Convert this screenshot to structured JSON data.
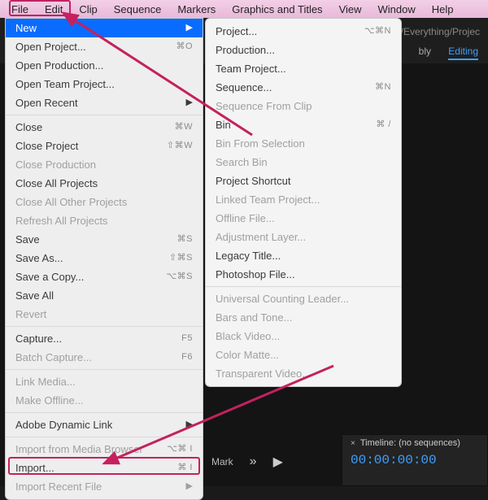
{
  "menubar": [
    "File",
    "Edit",
    "Clip",
    "Sequence",
    "Markers",
    "Graphics and Titles",
    "View",
    "Window",
    "Help"
  ],
  "dark": {
    "breadcrumb": "/Everything/Projec",
    "tab_active": "Editing",
    "tab_other": "bly"
  },
  "file_menu": [
    {
      "label": "New",
      "short": "",
      "arrow": true,
      "hot": true
    },
    {
      "label": "Open Project...",
      "short": "⌘O"
    },
    {
      "label": "Open Production..."
    },
    {
      "label": "Open Team Project..."
    },
    {
      "label": "Open Recent",
      "arrow": true
    },
    {
      "sep": true
    },
    {
      "label": "Close",
      "short": "⌘W"
    },
    {
      "label": "Close Project",
      "short": "⇧⌘W"
    },
    {
      "label": "Close Production",
      "dim": true
    },
    {
      "label": "Close All Projects"
    },
    {
      "label": "Close All Other Projects",
      "dim": true
    },
    {
      "label": "Refresh All Projects",
      "dim": true
    },
    {
      "label": "Save",
      "short": "⌘S"
    },
    {
      "label": "Save As...",
      "short": "⇧⌘S"
    },
    {
      "label": "Save a Copy...",
      "short": "⌥⌘S"
    },
    {
      "label": "Save All"
    },
    {
      "label": "Revert",
      "dim": true
    },
    {
      "sep": true
    },
    {
      "label": "Capture...",
      "short": "F5"
    },
    {
      "label": "Batch Capture...",
      "short": "F6",
      "dim": true
    },
    {
      "sep": true
    },
    {
      "label": "Link Media...",
      "dim": true
    },
    {
      "label": "Make Offline...",
      "dim": true
    },
    {
      "sep": true
    },
    {
      "label": "Adobe Dynamic Link",
      "arrow": true
    },
    {
      "sep": true
    },
    {
      "label": "Import from Media Browser",
      "short": "⌥⌘ I",
      "dim": true
    },
    {
      "label": "Import...",
      "short": "⌘ I"
    },
    {
      "label": "Import Recent File",
      "arrow": true,
      "dim": true
    }
  ],
  "new_submenu": [
    {
      "label": "Project...",
      "short": "⌥⌘N"
    },
    {
      "label": "Production..."
    },
    {
      "label": "Team Project..."
    },
    {
      "label": "Sequence...",
      "short": "⌘N"
    },
    {
      "label": "Sequence From Clip",
      "dim": true
    },
    {
      "label": "Bin",
      "short": "⌘ /"
    },
    {
      "label": "Bin From Selection",
      "dim": true
    },
    {
      "label": "Search Bin",
      "dim": true
    },
    {
      "label": "Project Shortcut"
    },
    {
      "label": "Linked Team Project...",
      "dim": true
    },
    {
      "label": "Offline File...",
      "dim": true
    },
    {
      "label": "Adjustment Layer...",
      "dim": true
    },
    {
      "label": "Legacy Title..."
    },
    {
      "label": "Photoshop File..."
    },
    {
      "sep": true
    },
    {
      "label": "Universal Counting Leader...",
      "dim": true
    },
    {
      "label": "Bars and Tone...",
      "dim": true
    },
    {
      "label": "Black Video...",
      "dim": true
    },
    {
      "label": "Color Matte...",
      "dim": true
    },
    {
      "label": "Transparent Video...",
      "dim": true
    }
  ],
  "timeline": {
    "title": "Timeline: (no sequences)",
    "timecode": "00:00:00:00",
    "mark_label": "Mark"
  }
}
